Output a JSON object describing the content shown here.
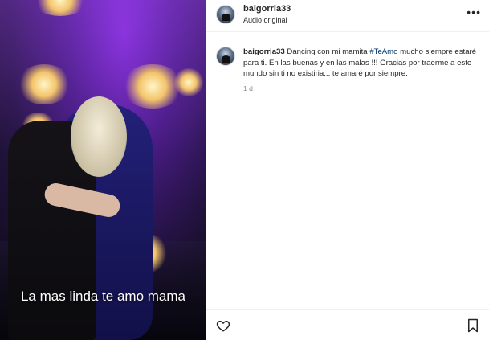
{
  "media": {
    "caption": "La mas linda te amo mama"
  },
  "header": {
    "username": "baigorria33",
    "audio": "Audio original",
    "more_icon": "more-horizontal-icon"
  },
  "comment": {
    "username": "baigorria33",
    "text_before": "Dancing con mi mamita ",
    "hashtag": "#TeAmo",
    "text_after": " mucho siempre estaré para ti. En las buenas y en las malas !!! Gracias por traerme a este mundo sin ti no existiria... te amaré por siempre.",
    "time": "1 d"
  },
  "footer": {
    "like_icon": "heart-icon",
    "save_icon": "bookmark-icon"
  },
  "colors": {
    "hashtag": "#00376b",
    "muted": "#8e8e8e",
    "text": "#262626"
  }
}
